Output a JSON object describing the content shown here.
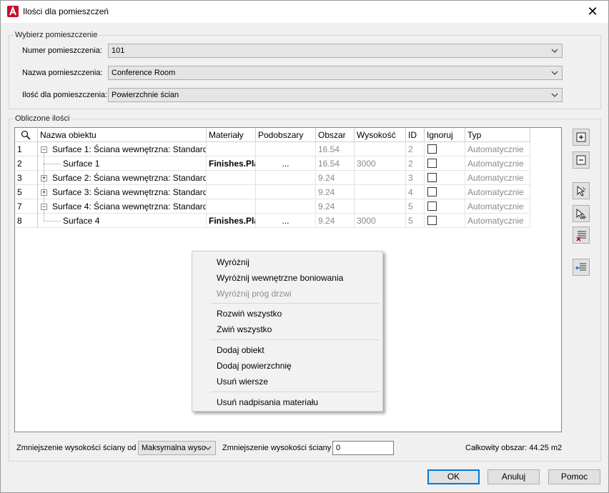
{
  "window": {
    "title": "Ilości dla pomieszczeń",
    "close_glyph": "✕"
  },
  "select_room": {
    "legend": "Wybierz pomieszczenie",
    "room_number_label": "Numer pomieszczenia:",
    "room_number_value": "101",
    "room_name_label": "Nazwa pomieszczenia:",
    "room_name_value": "Conference Room",
    "quantity_label": "Ilość dla pomieszczenia:",
    "quantity_value": "Powierzchnie ścian"
  },
  "computed": {
    "legend": "Obliczone ilości",
    "columns": [
      "Nazwa obiektu",
      "Materiały",
      "Podobszary",
      "Obszar",
      "Wysokość",
      "ID",
      "Ignoruj",
      "Typ"
    ],
    "rows": [
      {
        "num": "1",
        "name": "Surface 1: Ściana wewnętrzna: Standard",
        "material": "",
        "sub": "",
        "area": "16.54",
        "height": "",
        "id": "2",
        "type": "Automatycznie"
      },
      {
        "num": "2",
        "name": "Surface 1",
        "material": "Finishes.Pla",
        "sub": "...",
        "area": "16.54",
        "height": "3000",
        "id": "2",
        "type": "Automatycznie"
      },
      {
        "num": "3",
        "name": "Surface 2: Ściana wewnętrzna: Standard",
        "material": "",
        "sub": "",
        "area": "9.24",
        "height": "",
        "id": "3",
        "type": "Automatycznie"
      },
      {
        "num": "5",
        "name": "Surface 3: Ściana wewnętrzna: Standard",
        "material": "",
        "sub": "",
        "area": "9.24",
        "height": "",
        "id": "4",
        "type": "Automatycznie"
      },
      {
        "num": "7",
        "name": "Surface 4: Ściana wewnętrzna: Standard",
        "material": "",
        "sub": "",
        "area": "9.24",
        "height": "",
        "id": "5",
        "type": "Automatycznie"
      },
      {
        "num": "8",
        "name": "Surface 4",
        "material": "Finishes.Pla",
        "sub": "...",
        "area": "9.24",
        "height": "3000",
        "id": "5",
        "type": "Automatycznie"
      }
    ]
  },
  "context_menu": {
    "items": [
      "Wyróżnij",
      "Wyróżnij wewnętrzne boniowania",
      "Wyróżnij próg drzwi",
      "Rozwiń wszystko",
      "Zwiń wszystko",
      "Dodaj obiekt",
      "Dodaj powierzchnię",
      "Usuń wiersze",
      "Usuń nadpisania materiału"
    ]
  },
  "bottom": {
    "reduce_from_label": "Zmniejszenie wysokości ściany od",
    "reduce_from_value": "Maksymalna wyso",
    "reduce_label": "Zmniejszenie wysokości ściany",
    "reduce_value": "0",
    "total_area": "Całkowity obszar: 44.25 m2"
  },
  "buttons": {
    "ok": "OK",
    "cancel": "Anuluj",
    "help": "Pomoc"
  },
  "colors": {
    "accent": "#0078d7",
    "app_icon": "#c8102e"
  }
}
